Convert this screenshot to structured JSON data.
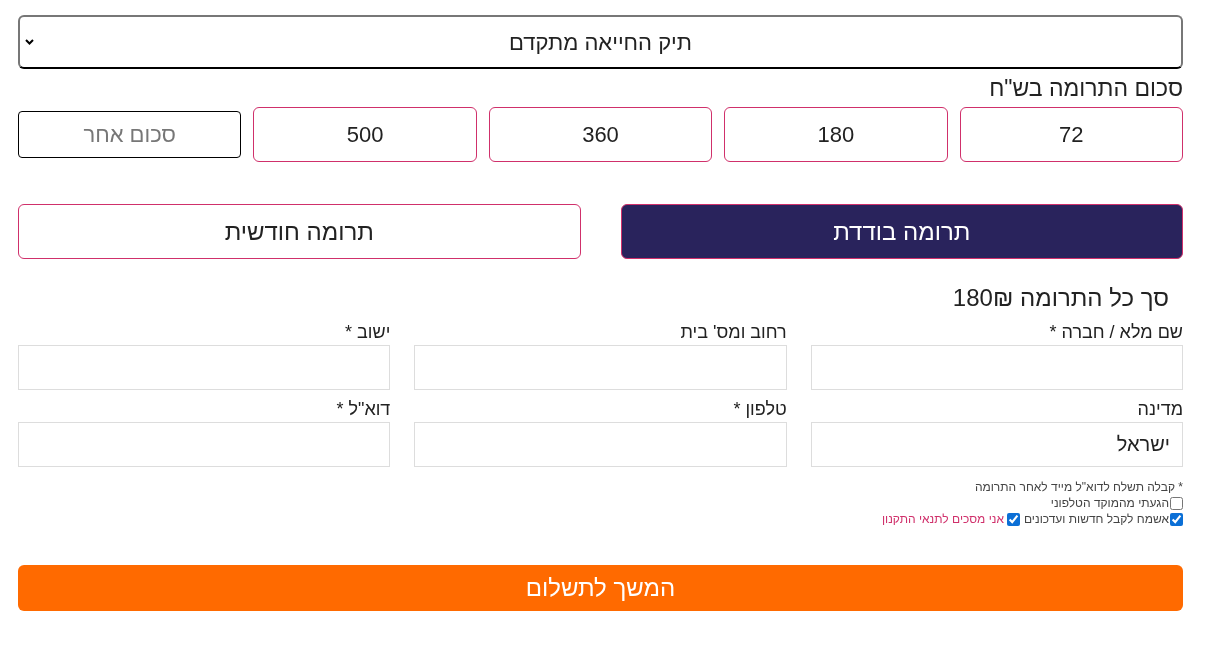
{
  "fund_select": {
    "value": "תיק החייאה מתקדם"
  },
  "amount_heading": "סכום התרומה בש\"ח",
  "amounts": [
    "72",
    "180",
    "360",
    "500"
  ],
  "other_amount": {
    "placeholder": "סכום אחר"
  },
  "frequency_tabs": [
    {
      "label": "תרומה בודדת",
      "selected": true
    },
    {
      "label": "תרומה חודשית",
      "selected": false
    }
  ],
  "total": "סך כל התרומה 180₪",
  "fields": [
    {
      "label": "שם מלא / חברה *"
    },
    {
      "label": "רחוב ומס' בית"
    },
    {
      "label": "ישוב *"
    },
    {
      "label": "מדינה",
      "value": "ישראל"
    },
    {
      "label": "טלפון *"
    },
    {
      "label": "דוא\"ל *"
    }
  ],
  "receipt_note": "* קבלה תשלח לדוא\"ל מייד לאחר התרומה",
  "checkbox_rows": [
    [
      {
        "label": "הגעתי מהמוקד הטלפוני",
        "checked": false,
        "kind": "plain"
      }
    ],
    [
      {
        "label": "אשמח לקבל חדשות ועדכונים",
        "checked": true,
        "kind": "plain"
      },
      {
        "label": "אני מסכים לתנאי התקנון",
        "checked": true,
        "kind": "link"
      }
    ]
  ],
  "submit_button": "המשך לתשלום"
}
